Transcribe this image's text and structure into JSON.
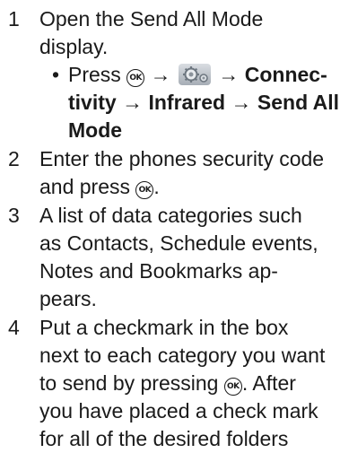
{
  "steps": [
    {
      "number": "1",
      "lines": [
        "Open the Send All Mode",
        "display."
      ],
      "sub": {
        "bullet": "•",
        "press": "Press",
        "arrow": "→",
        "ok_label": "OK",
        "icon": "settings-gear-icon",
        "path_a": "Connec-",
        "path_b1": "tivity",
        "path_b2": "Infrared",
        "path_b3": "Send All",
        "path_c": "Mode"
      }
    },
    {
      "number": "2",
      "lines": [
        "Enter the phones security code"
      ],
      "line2_text": "and press",
      "line2_end": "."
    },
    {
      "number": "3",
      "lines": [
        "A list of data categories such",
        "as Contacts, Schedule events,",
        "Notes and Bookmarks ap-",
        "pears."
      ]
    },
    {
      "number": "4",
      "lines": [
        "Put a checkmark in the box",
        "next to each category you want"
      ],
      "line3_text": "to send by pressing",
      "line3_end": ". After",
      "lines_after": [
        "you have placed a check mark",
        "for all of the desired folders"
      ]
    }
  ]
}
